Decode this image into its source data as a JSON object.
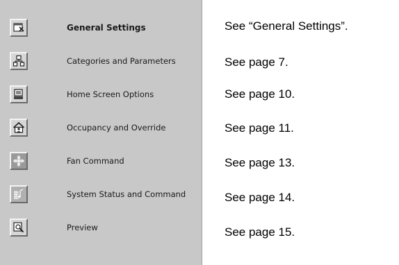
{
  "nav": {
    "items": [
      {
        "label": "General Settings",
        "icon": "settings-icon",
        "reference": "See “General Settings”."
      },
      {
        "label": "Categories and Parameters",
        "icon": "hierarchy-icon",
        "reference": "See page 7."
      },
      {
        "label": "Home Screen Options",
        "icon": "home-screen-icon",
        "reference": "See page 10."
      },
      {
        "label": "Occupancy and Override",
        "icon": "occupancy-icon",
        "reference": "See page 11."
      },
      {
        "label": "Fan Command",
        "icon": "fan-icon",
        "reference": "See page 13."
      },
      {
        "label": "System Status and Command",
        "icon": "system-status-icon",
        "reference": "See page 14."
      },
      {
        "label": "Preview",
        "icon": "preview-icon",
        "reference": "See page 15."
      }
    ]
  }
}
